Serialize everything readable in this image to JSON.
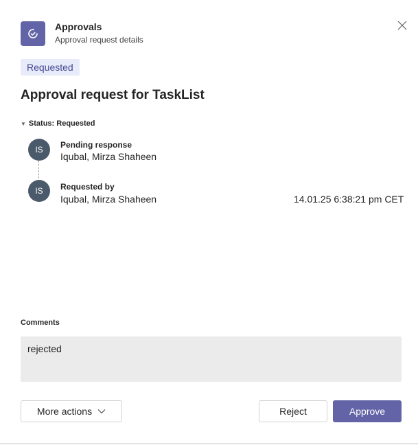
{
  "header": {
    "app_title": "Approvals",
    "app_subtitle": "Approval request details",
    "app_icon": "approvals-icon",
    "close_icon": "close-icon"
  },
  "status_pill": "Requested",
  "request_title": "Approval request for TaskList",
  "status_section": {
    "toggle_label": "Status: Requested",
    "steps": [
      {
        "initials": "IS",
        "label": "Pending response",
        "name": "Iqubal, Mirza Shaheen",
        "timestamp": ""
      },
      {
        "initials": "IS",
        "label": "Requested by",
        "name": "Iqubal, Mirza Shaheen",
        "timestamp": "14.01.25 6:38:21 pm CET"
      }
    ]
  },
  "comments": {
    "label": "Comments",
    "text": "rejected"
  },
  "actions": {
    "more_actions_label": "More actions",
    "reject_label": "Reject",
    "approve_label": "Approve"
  },
  "colors": {
    "brand": "#6264a7",
    "pill_bg": "#e8ebfa",
    "avatar_bg": "#4a5a6a",
    "comments_bg": "#ebebeb"
  }
}
